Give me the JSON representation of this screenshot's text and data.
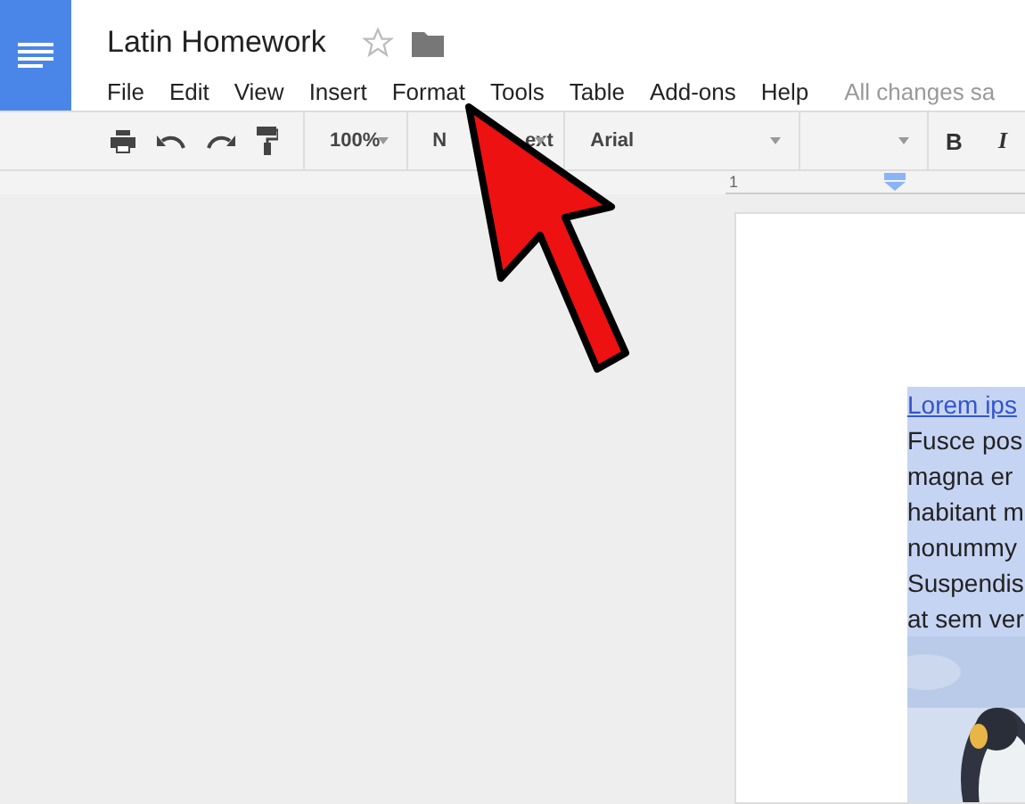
{
  "document": {
    "title": "Latin Homework",
    "starred": false
  },
  "menu": [
    "File",
    "Edit",
    "View",
    "Insert",
    "Format",
    "Tools",
    "Table",
    "Add-ons",
    "Help"
  ],
  "save_status": "All changes sa",
  "toolbar": {
    "zoom": "100%",
    "style": [
      "N",
      "ext"
    ],
    "font": "Arial",
    "bold": "B",
    "italic": "I"
  },
  "ruler": {
    "mark": "1"
  },
  "page": {
    "link": "Lorem ips",
    "lines": [
      "Fusce pos",
      "magna er",
      "habitant m",
      "nonummy",
      "Suspendis",
      "at sem ver"
    ],
    "selected": true
  }
}
